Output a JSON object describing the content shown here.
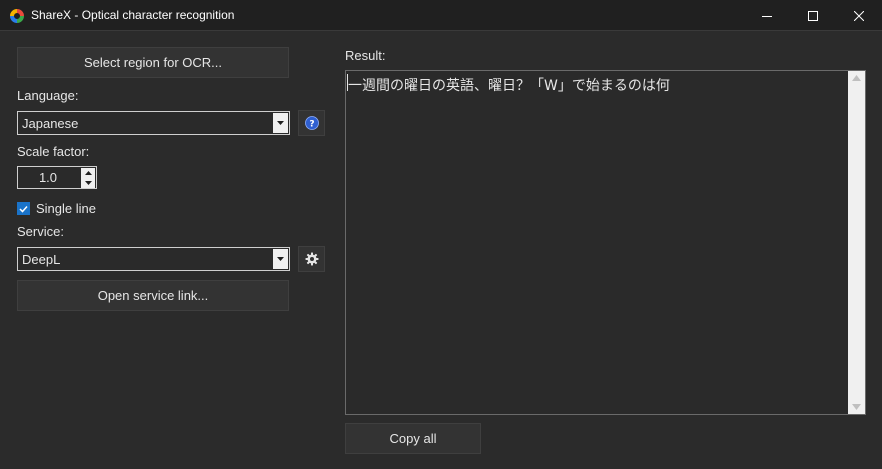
{
  "window": {
    "title": "ShareX - Optical character recognition"
  },
  "left": {
    "select_region_label": "Select region for OCR...",
    "language_label": "Language:",
    "language_value": "Japanese",
    "scale_label": "Scale factor:",
    "scale_value": "1.0",
    "single_line_label": "Single line",
    "single_line_checked": true,
    "service_label": "Service:",
    "service_value": "DeepL",
    "open_service_label": "Open service link..."
  },
  "right": {
    "result_label": "Result:",
    "result_text": "一週間の曜日の英語、曜日？「W」で始まるのは何",
    "copy_all_label": "Copy all"
  },
  "colors": {
    "background": "#2b2b2b",
    "titlebar": "#202020",
    "checkbox_accent": "#1a73c9",
    "help_icon": "#2f5fd0"
  }
}
